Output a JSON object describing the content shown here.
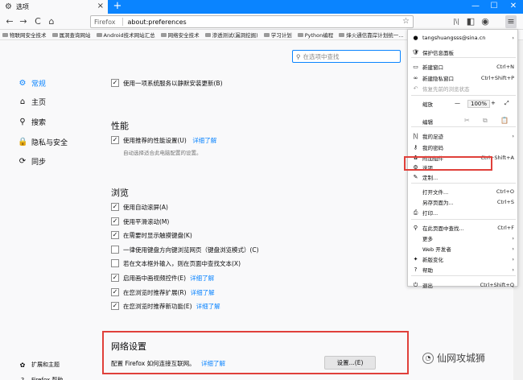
{
  "tab": {
    "title": "选项",
    "close": "×",
    "icon": "gear-icon"
  },
  "newtab": "+",
  "window": {
    "minimize": "—",
    "maximize": "☐",
    "close": "✕"
  },
  "nav": {
    "back": "←",
    "forward": "→",
    "reload": "C",
    "home": "⌂",
    "identity": "Firefox",
    "url": "about:preferences",
    "star": "☆"
  },
  "toolbar": {
    "library": "|\\|",
    "sidebar": "◧",
    "account": "◉",
    "menu": "≡"
  },
  "bookmarks": [
    "物联网安全技术",
    "属洞查询网站",
    "Android技术网站汇总",
    "网络安全技术",
    "渗透测试(漏洞挖掘)",
    "学习计划",
    "Python编程",
    "烽火通信靠岸计划统一..."
  ],
  "sidebar": [
    {
      "label": "常规",
      "icon": "⚙"
    },
    {
      "label": "主页",
      "icon": "⌂"
    },
    {
      "label": "搜索",
      "icon": "⚲"
    },
    {
      "label": "隐私与安全",
      "icon": "🔒"
    },
    {
      "label": "同步",
      "icon": "⟳"
    }
  ],
  "sidebar_bottom": [
    {
      "label": "扩展和主题",
      "icon": "✿"
    },
    {
      "label": "Firefox 帮助",
      "icon": "?"
    }
  ],
  "search_placeholder": "在选项中查找",
  "content": {
    "update": "使用一项系统服务以静默安装更新(B)",
    "perf_title": "性能",
    "perf_rec": "使用推荐的性能设置(U)",
    "learn_more": "详细了解",
    "perf_sub": "自动选择适合此电脑配置的设置。",
    "browse_title": "浏览",
    "browse": [
      {
        "label": "使用自动滚屏(A)",
        "checked": true,
        "link": ""
      },
      {
        "label": "使用平滑滚动(M)",
        "checked": true,
        "link": ""
      },
      {
        "label": "在需要时显示触摸键盘(K)",
        "checked": true,
        "link": ""
      },
      {
        "label": "一律使用键盘方向键浏览网页（键盘浏览模式）(C)",
        "checked": false,
        "link": ""
      },
      {
        "label": "若在文本框外输入，则在页面中查找文本(X)",
        "checked": false,
        "link": ""
      },
      {
        "label": "启用画中画视频控件(E)",
        "checked": true,
        "link": "详细了解"
      },
      {
        "label": "在您浏览时推荐扩展(R)",
        "checked": true,
        "link": "详细了解"
      },
      {
        "label": "在您浏览时推荐新功能(E)",
        "checked": true,
        "link": "详细了解"
      }
    ],
    "net_title": "网络设置",
    "net_desc": "配置 Firefox 如何连接互联网。",
    "net_link": "详细了解",
    "net_button": "设置...(E)"
  },
  "menu": {
    "account": "tangshuangsss@sina.cn",
    "items": [
      {
        "label": "保护信息面板",
        "icon": "🛡",
        "shortcut": ""
      },
      {
        "label": "新建窗口",
        "icon": "▭",
        "shortcut": "Ctrl+N"
      },
      {
        "label": "新建隐私窗口",
        "icon": "∞",
        "shortcut": "Ctrl+Shift+P"
      },
      {
        "label": "恢复先前的浏览状态",
        "icon": "↶",
        "shortcut": ""
      },
      {
        "label": "缩放",
        "icon": "",
        "shortcut": ""
      },
      {
        "label": "编辑",
        "icon": "",
        "shortcut": ""
      },
      {
        "label": "我的足迹",
        "icon": "|\\|",
        "shortcut": "›"
      },
      {
        "label": "我的密码",
        "icon": "⚷",
        "shortcut": ""
      },
      {
        "label": "附加组件",
        "icon": "✿",
        "shortcut": "Ctrl+Shift+A"
      },
      {
        "label": "选项",
        "icon": "⚙",
        "shortcut": ""
      },
      {
        "label": "定制...",
        "icon": "✎",
        "shortcut": ""
      },
      {
        "label": "打开文件...",
        "icon": "",
        "shortcut": "Ctrl+O"
      },
      {
        "label": "另存页面为...",
        "icon": "",
        "shortcut": "Ctrl+S"
      },
      {
        "label": "打印...",
        "icon": "⎙",
        "shortcut": ""
      },
      {
        "label": "在此页面中查找...",
        "icon": "⚲",
        "shortcut": "Ctrl+F"
      },
      {
        "label": "更多",
        "icon": "",
        "shortcut": "›"
      },
      {
        "label": "Web 开发者",
        "icon": "",
        "shortcut": "›"
      },
      {
        "label": "新版变化",
        "icon": "✦",
        "shortcut": "›"
      },
      {
        "label": "帮助",
        "icon": "?",
        "shortcut": "›"
      },
      {
        "label": "退出",
        "icon": "⏻",
        "shortcut": "Ctrl+Shift+Q"
      }
    ],
    "zoom": {
      "minus": "—",
      "value": "100%",
      "plus": "+",
      "fullscreen": "⤢"
    },
    "edit": {
      "cut": "✂",
      "copy": "⧉",
      "paste": "📋"
    }
  },
  "watermark": "仙网攻城狮"
}
